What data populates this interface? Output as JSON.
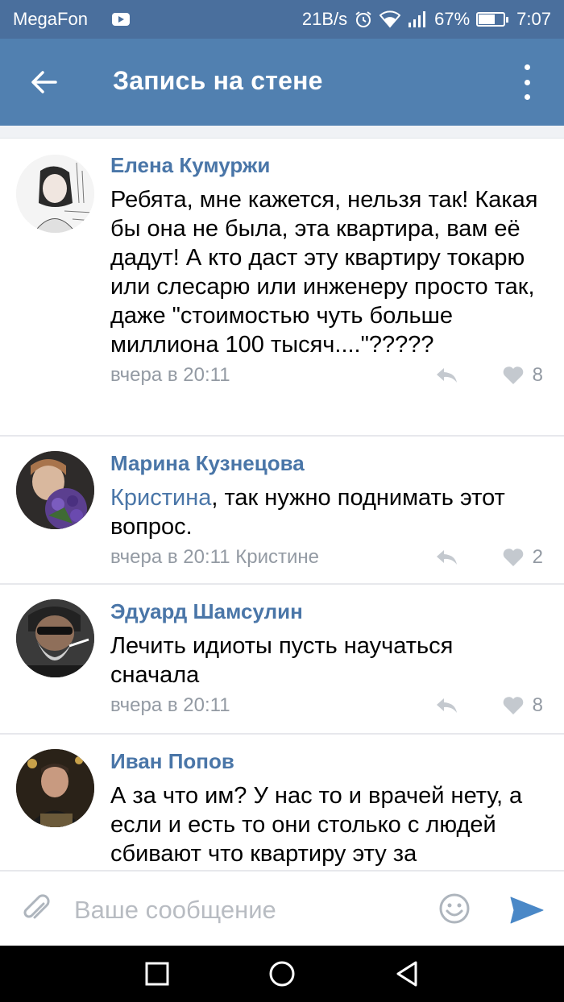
{
  "status_bar": {
    "carrier": "MegaFon",
    "speed": "21B/s",
    "battery": "67%",
    "battery_level": 0.67,
    "time": "7:07"
  },
  "header": {
    "title": "Запись на стене",
    "back_icon": "arrow-left-icon",
    "menu_icon": "more-vert-icon"
  },
  "comments": [
    {
      "author": "Елена Кумуржи",
      "mention": "",
      "text": "Ребята, мне кажется, нельзя так! Какая бы она не была, эта квартира, вам её дадут! А кто даст эту квартиру токарю или слесарю или инженеру просто так, даже \"стоимостью чуть больше миллиона 100 тысяч....\"?????",
      "time": "вчера в 20:11",
      "likes": "8",
      "avatar": "sketch-portrait"
    },
    {
      "author": "Марина Кузнецова",
      "mention": "Кристина",
      "text": ", так нужно поднимать этот вопрос.",
      "time": "вчера в 20:11 Кристине",
      "likes": "2",
      "avatar": "woman-with-flowers"
    },
    {
      "author": "Эдуард Шамсулин",
      "mention": "",
      "text": "Лечить идиоты пусть научаться сначала",
      "time": "вчера в 20:11",
      "likes": "8",
      "avatar": "bearded-man-sunglasses"
    },
    {
      "author": "Иван Попов",
      "mention": "",
      "text": "А за что им? У нас то и врачей нету, а если и есть то они столько с людей сбивают что квартиру эту за",
      "time": "",
      "likes": "",
      "avatar": "man-dark-background"
    }
  ],
  "input": {
    "placeholder": "Ваше сообщение"
  },
  "colors": {
    "status_bar": "#4a6f9d",
    "header": "#5180b0",
    "author": "#4a76a8",
    "meta": "#939aa3",
    "send": "#4a88c7"
  }
}
